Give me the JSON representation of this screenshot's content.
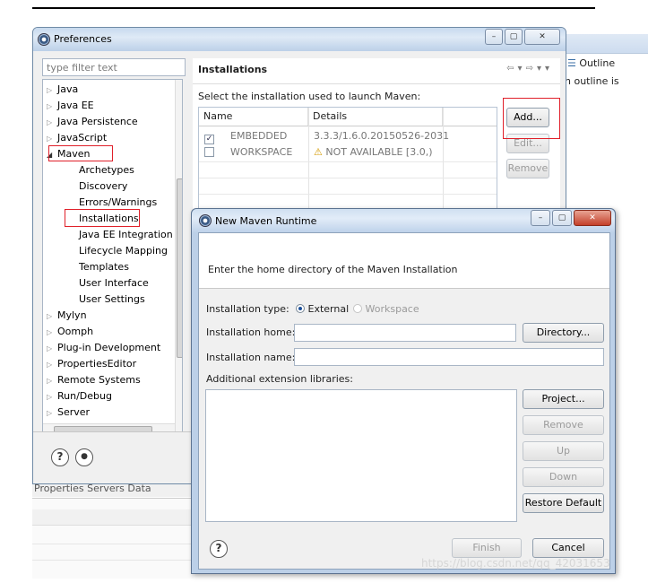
{
  "background": {
    "outline_tab": "Outline",
    "outline_text": "n outline is",
    "bottom_tabs": "Properties  Servers  Data"
  },
  "preferences": {
    "title": "Preferences",
    "filter_placeholder": "type filter text",
    "tree": [
      {
        "label": "Java",
        "arrow": "▷"
      },
      {
        "label": "Java EE",
        "arrow": "▷"
      },
      {
        "label": "Java Persistence",
        "arrow": "▷"
      },
      {
        "label": "JavaScript",
        "arrow": "▷"
      },
      {
        "label": "Maven",
        "arrow": "◢"
      },
      {
        "label": "Archetypes",
        "arrow": ""
      },
      {
        "label": "Discovery",
        "arrow": ""
      },
      {
        "label": "Errors/Warnings",
        "arrow": ""
      },
      {
        "label": "Installations",
        "arrow": ""
      },
      {
        "label": "Java EE Integration",
        "arrow": ""
      },
      {
        "label": "Lifecycle Mapping",
        "arrow": ""
      },
      {
        "label": "Templates",
        "arrow": ""
      },
      {
        "label": "User Interface",
        "arrow": ""
      },
      {
        "label": "User Settings",
        "arrow": ""
      },
      {
        "label": "Mylyn",
        "arrow": "▷"
      },
      {
        "label": "Oomph",
        "arrow": "▷"
      },
      {
        "label": "Plug-in Development",
        "arrow": "▷"
      },
      {
        "label": "PropertiesEditor",
        "arrow": "▷"
      },
      {
        "label": "Remote Systems",
        "arrow": "▷"
      },
      {
        "label": "Run/Debug",
        "arrow": "▷"
      },
      {
        "label": "Server",
        "arrow": "▷"
      }
    ],
    "page_title": "Installations",
    "select_text": "Select the installation used to launch Maven:",
    "table_headers": [
      "Name",
      "Details"
    ],
    "rows": [
      {
        "checked": "✓",
        "name": "EMBEDDED",
        "details": "3.3.3/1.6.0.20150526-2031",
        "warn": ""
      },
      {
        "checked": "",
        "name": "WORKSPACE",
        "details": "NOT AVAILABLE [3.0,)",
        "warn": "⚠"
      }
    ],
    "buttons": {
      "add": "Add...",
      "edit": "Edit...",
      "remove": "Remove"
    },
    "help_icon": "?"
  },
  "dialog": {
    "title": "New Maven Runtime",
    "message": "Enter the home directory of the Maven Installation",
    "installation_type_label": "Installation type:",
    "external_label": "External",
    "workspace_label": "Workspace",
    "home_label": "Installation home:",
    "home_value": "",
    "name_label": "Installation name:",
    "name_value": "",
    "ext_libs_label": "Additional extension libraries:",
    "buttons": {
      "directory": "Directory...",
      "project": "Project...",
      "remove": "Remove",
      "up": "Up",
      "down": "Down",
      "restore": "Restore Default",
      "finish": "Finish",
      "cancel": "Cancel"
    },
    "help_icon": "?"
  },
  "watermark": "https://blog.csdn.net/qq_42031653"
}
